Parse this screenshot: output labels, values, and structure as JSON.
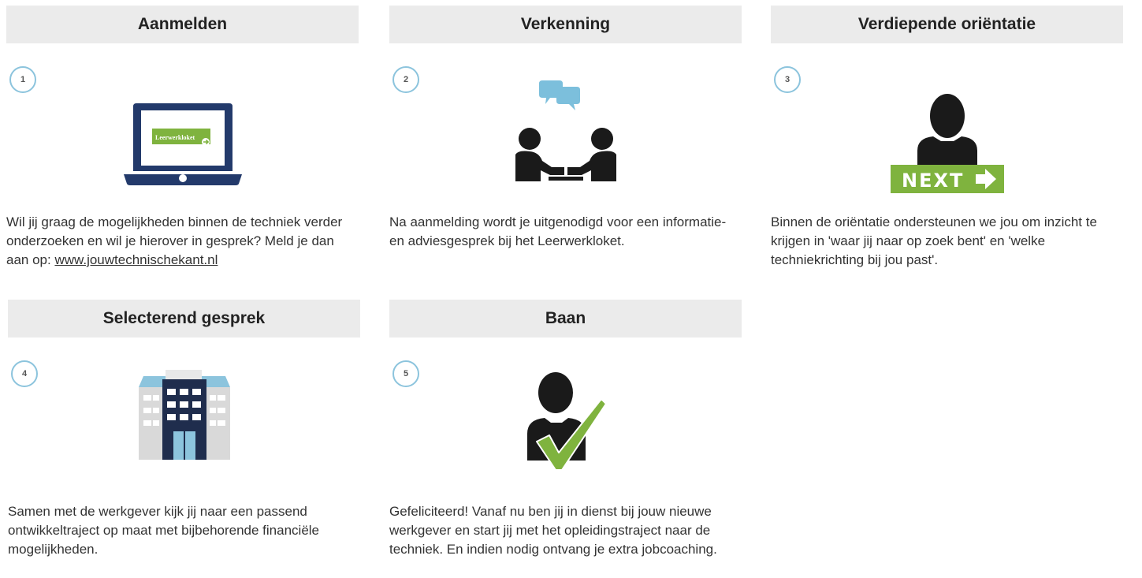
{
  "cards": [
    {
      "title": "Aanmelden",
      "step": "1",
      "icon": "laptop-icon",
      "screen_label": "Leerwerkloket",
      "text_before": "Wil jij graag de mogelijkheden binnen de techniek verder onderzoeken en wil je hierover in gesprek? Meld je dan aan op: ",
      "link": "www.jouwtechnischekant.nl"
    },
    {
      "title": "Verkenning",
      "step": "2",
      "icon": "conversation-icon",
      "text": "Na aanmelding wordt je uitgenodigd voor een informatie- en adviesgesprek bij het Leerwerkloket."
    },
    {
      "title": "Verdiepende oriëntatie",
      "step": "3",
      "icon": "person-next-icon",
      "badge": "NEXT",
      "text": "Binnen de oriëntatie ondersteunen we jou om inzicht te krijgen in 'waar jij naar op zoek bent' en 'welke techniekrichting bij jou past'."
    },
    {
      "title": "Selecterend gesprek",
      "step": "4",
      "icon": "office-building-icon",
      "text": "Samen met de werkgever kijk jij naar een passend ontwikkeltraject op maat met bijbehorende financiële mogelijkheden."
    },
    {
      "title": "Baan",
      "step": "5",
      "icon": "person-check-icon",
      "text": "Gefeliciteerd! Vanaf nu ben jij in dienst bij jouw nieuwe werkgever en start jij met het opleidingstraject naar de techniek. En indien nodig ontvang je extra jobcoaching."
    }
  ],
  "colors": {
    "header_bg": "#ebebeb",
    "step_circle": "#8cc4dd",
    "laptop": "#233a6b",
    "green": "#7fb33e",
    "bubble": "#7cbfdc",
    "person": "#1a1a1a",
    "building_dark": "#1f2d4d",
    "building_light": "#8cc4dd"
  }
}
